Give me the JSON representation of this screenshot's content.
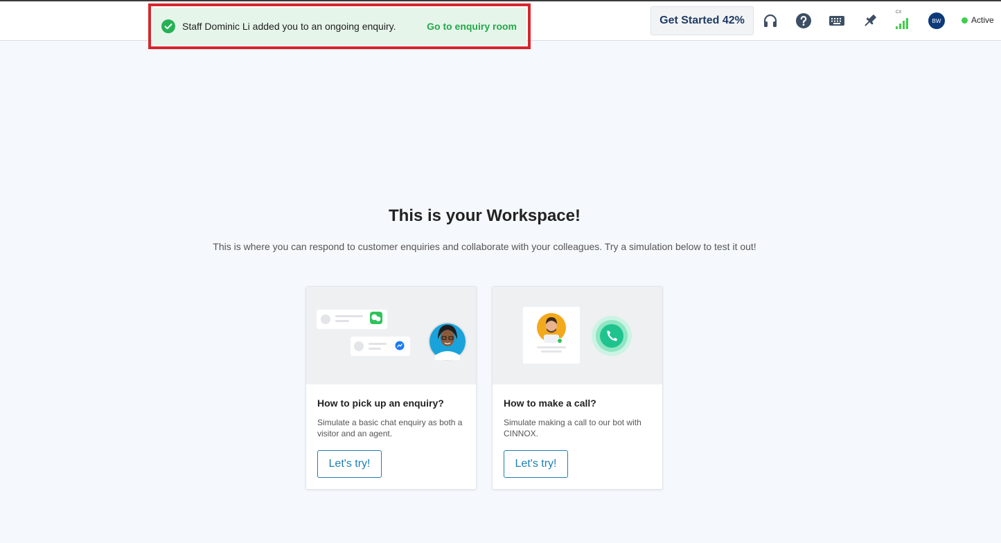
{
  "toast": {
    "message": "Staff Dominic Li added you to an ongoing enquiry.",
    "link": "Go to enquiry room"
  },
  "header": {
    "get_started": "Get Started 42%",
    "icons": [
      "headset-icon",
      "help-icon",
      "keyboard-icon",
      "pin-icon",
      "signal-icon"
    ],
    "signal_label": "CX",
    "avatar_initials": "BW",
    "status": "Active"
  },
  "main": {
    "title": "This is your Workspace!",
    "subtitle": "This is where you can respond to customer enquiries and collaborate with your colleagues. Try a simulation below to test it out!",
    "cards": [
      {
        "title": "How to pick up an enquiry?",
        "description": "Simulate a basic chat enquiry as both a visitor and an agent.",
        "button": "Let's try!"
      },
      {
        "title": "How to make a call?",
        "description": "Simulate making a call to our bot with CINNOX.",
        "button": "Let's try!"
      }
    ]
  },
  "colors": {
    "accent": "#1b7eb3",
    "success": "#23a84a",
    "highlight": "#d7262c",
    "status_active": "#3ecf4a",
    "avatar": "#0e3a7a"
  }
}
